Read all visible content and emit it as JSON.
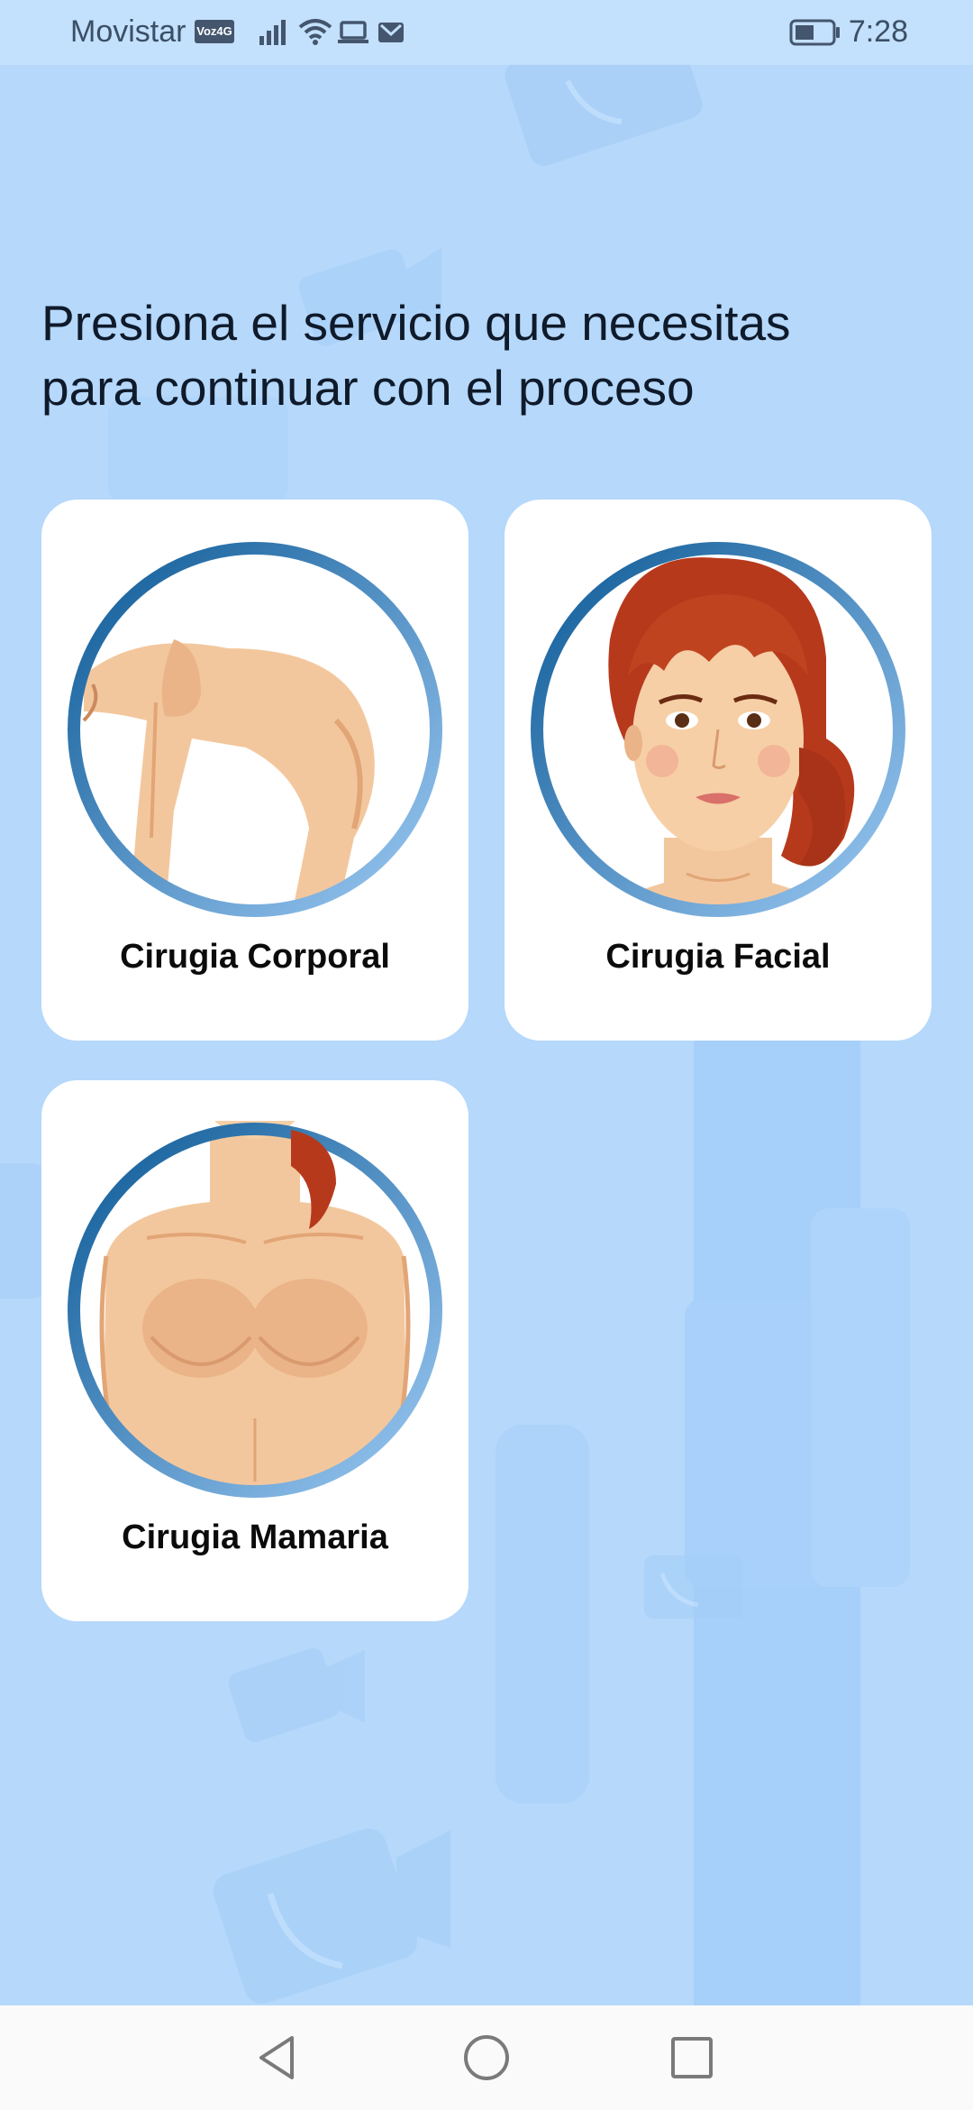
{
  "status_bar": {
    "carrier": "Movistar",
    "volte_badge": "Voz4G",
    "time": "7:28"
  },
  "heading": {
    "line1": "Presiona el servicio que necesitas",
    "line2": "para continuar con el proceso"
  },
  "services": [
    {
      "label": "Cirugia Corporal",
      "icon": "body-surgery-icon"
    },
    {
      "label": "Cirugia Facial",
      "icon": "face-surgery-icon"
    },
    {
      "label": "Cirugia Mamaria",
      "icon": "breast-surgery-icon"
    }
  ],
  "navigation": {
    "back": "back-icon",
    "home": "home-icon",
    "recent": "recent-apps-icon"
  },
  "colors": {
    "background": "#b5d8fb",
    "card": "#ffffff",
    "ring_dark": "#0d5a96",
    "ring_light": "#9cc9f3",
    "skin": "#f3c79d",
    "hair": "#b7391c"
  }
}
